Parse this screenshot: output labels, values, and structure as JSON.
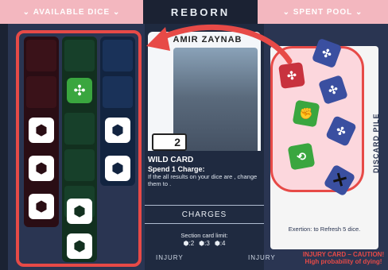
{
  "header": {
    "available_dice": "AVAILABLE DICE",
    "game_title": "REBORN",
    "spent_pool": "SPENT POOL"
  },
  "character_card": {
    "name": "AMIR ZAYNAB",
    "level": "2",
    "ability_title": "WILD CARD",
    "ability_cost": "Spend 1 Charge:",
    "ability_text": "If the all results on your dice are , change them to .",
    "charges_label": "CHARGES",
    "limit_label": "Section card limit:",
    "limits": [
      ":2",
      ":3",
      ":4"
    ]
  },
  "available_dice": {
    "columns": [
      {
        "color": "red",
        "slots": 6,
        "dice": [
          {
            "row": 3,
            "icon": "shield-icon"
          },
          {
            "row": 4,
            "icon": "shield-icon"
          },
          {
            "row": 5,
            "icon": "shield-icon"
          }
        ]
      },
      {
        "color": "green",
        "slots": 7,
        "dice": [
          {
            "row": 1,
            "icon": "arrows-icon"
          },
          {
            "row": 5,
            "icon": "shield-icon"
          },
          {
            "row": 6,
            "icon": "shield-icon"
          }
        ]
      },
      {
        "color": "blue",
        "slots": 4,
        "dice": [
          {
            "row": 2,
            "icon": "shield-icon"
          },
          {
            "row": 3,
            "icon": "shield-icon"
          }
        ]
      }
    ]
  },
  "spent_dice": [
    "red arrows",
    "blue arrows",
    "blue arrows",
    "green fist",
    "blue arrows",
    "green shield",
    "blue crossed"
  ],
  "discard_label": "DISCARD PILE",
  "exertion_text": "Exertion:  to Refresh 5 dice.",
  "injury": {
    "left": "INJURY",
    "mid": "INJURY",
    "card_title": "INJURY CARD – CAUTION!",
    "card_sub": "High probability of dying!"
  },
  "colors": {
    "accent": "#e74a47",
    "panel": "#2a3552",
    "red_die": "#c8323e",
    "green_die": "#3aa63f",
    "blue_die": "#3a4fa0"
  }
}
